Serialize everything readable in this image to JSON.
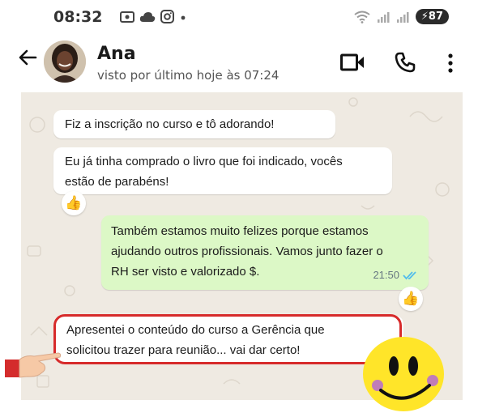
{
  "status_bar": {
    "time": "08:32",
    "battery": "87",
    "left_icons": [
      "screenshot-icon",
      "cloud-icon",
      "instagram-icon",
      "dot-icon"
    ],
    "right_icons": [
      "wifi-icon",
      "signal-icon",
      "signal-icon"
    ]
  },
  "header": {
    "name": "Ana",
    "last_seen": "visto por último hoje às 07:24"
  },
  "messages": [
    {
      "direction": "in",
      "text": "Fiz a inscrição no curso e tô adorando!"
    },
    {
      "direction": "in",
      "text_lines": [
        "Eu já tinha comprado o livro que foi indicado, vocês",
        "estão de parabéns!"
      ],
      "reaction": "👍"
    },
    {
      "direction": "out",
      "text_lines": [
        "Também estamos muito felizes porque estamos",
        "ajudando outros profissionais. Vamos junto fazer o",
        "RH ser visto e valorizado $."
      ],
      "time": "21:50",
      "status": "read",
      "reaction": "👍"
    },
    {
      "direction": "in",
      "text_lines": [
        "Apresentei o conteúdo do curso a Gerência que",
        "solicitou trazer para reunião... vai dar certo!"
      ],
      "highlighted": true
    }
  ],
  "colors": {
    "chat_background": "#efeae2",
    "incoming_bubble": "#ffffff",
    "outgoing_bubble": "#dcf8c6",
    "read_ticks": "#53bdeb",
    "highlight_border": "#d72b2b"
  }
}
